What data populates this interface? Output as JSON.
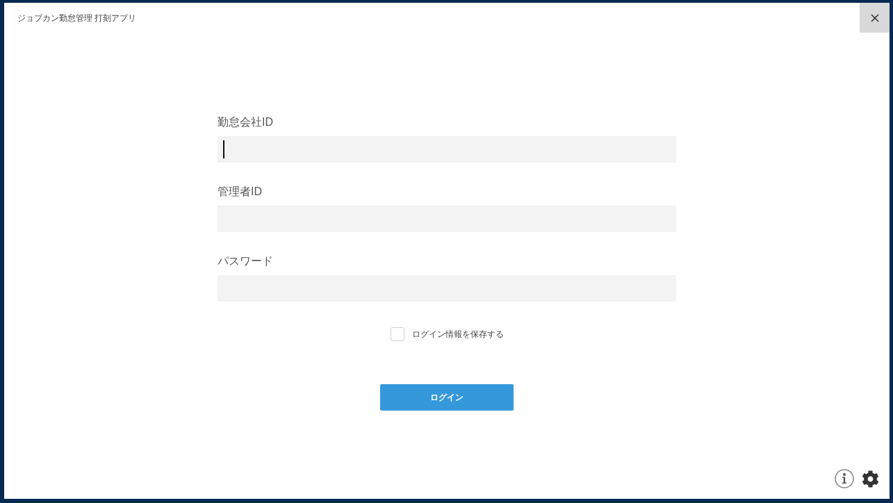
{
  "window": {
    "title": "ジョブカン勤怠管理 打刻アプリ"
  },
  "form": {
    "fields": [
      {
        "label": "勤怠会社ID",
        "focused": true
      },
      {
        "label": "管理者ID",
        "focused": false
      },
      {
        "label": "パスワード",
        "focused": false
      }
    ],
    "remember": {
      "label": "ログイン情報を保存する",
      "checked": false
    },
    "login_button": {
      "label": "ログイン"
    }
  }
}
